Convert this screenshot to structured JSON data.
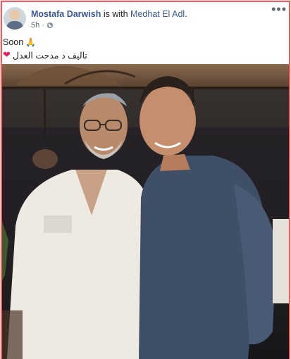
{
  "post": {
    "author": "Mostafa Darwish",
    "with_text": "is with",
    "with_name": "Medhat El Adl",
    "with_suffix": ".",
    "time": "5h",
    "more_label": "•••",
    "caption_line1": "Soon",
    "caption_line2": "تاليف د مدحت العدل",
    "icons": [
      "avatar",
      "globe-icon",
      "folded-hands-emoji",
      "red-heart-emoji",
      "more-options-icon"
    ]
  },
  "colors": {
    "link": "#385898",
    "text": "#1c1e21",
    "meta": "#606770",
    "heart": "#e0245e",
    "frame": "#ff5a5a"
  }
}
